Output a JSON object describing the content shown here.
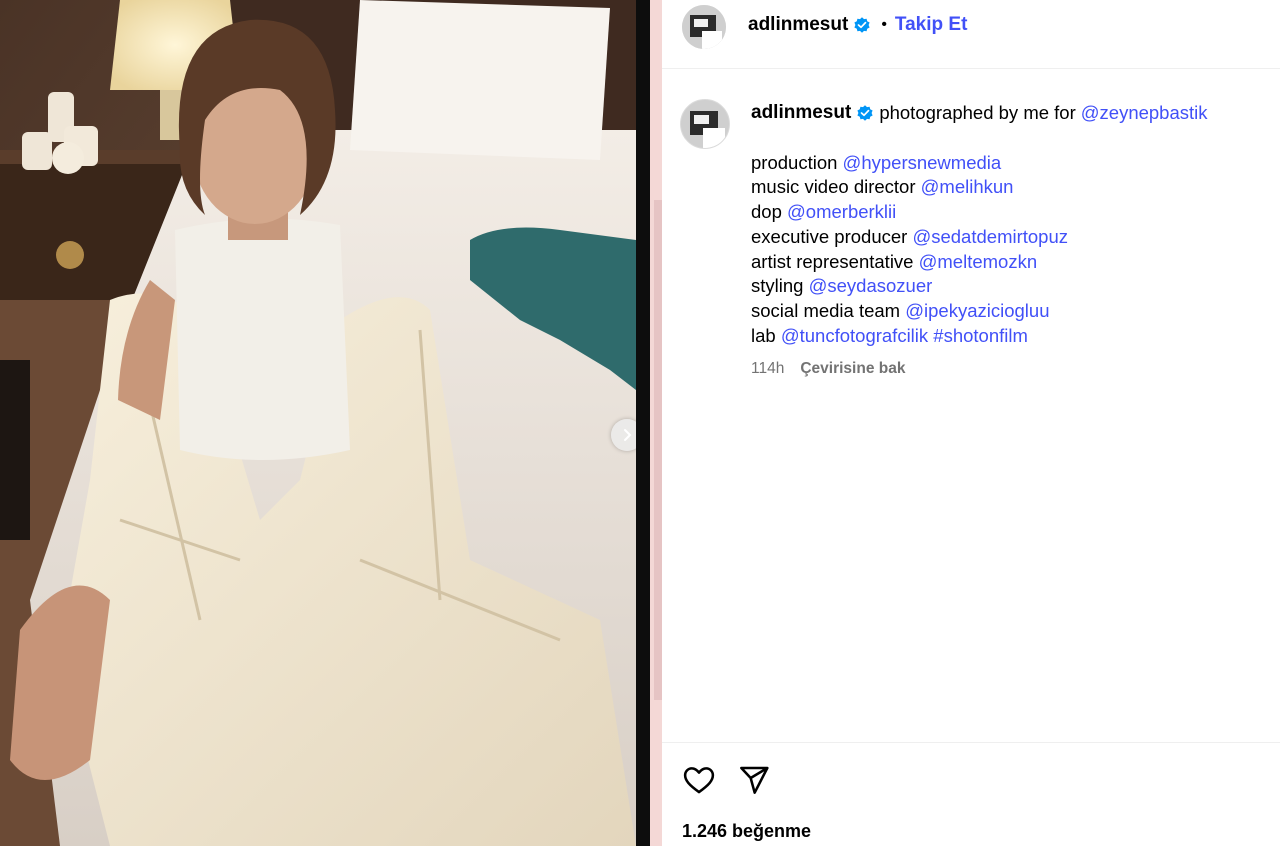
{
  "post": {
    "username": "adlinmesut",
    "follow_label": "Takip Et",
    "separator": "•"
  },
  "caption": {
    "username": "adlinmesut",
    "intro_text": "photographed by me for",
    "intro_mention": "@zeynepbastik",
    "credits": [
      {
        "label": "production",
        "mention": "@hypersnewmedia"
      },
      {
        "label": "music video director",
        "mention": "@melihkun"
      },
      {
        "label": "dop",
        "mention": "@omerberklii"
      },
      {
        "label": "executive producer",
        "mention": "@sedatdemirtopuz"
      },
      {
        "label": "artist representative",
        "mention": "@meltemozkn"
      },
      {
        "label": "styling",
        "mention": "@seydasozuer"
      },
      {
        "label": "social media team",
        "mention": "@ipekyaziciogluu"
      },
      {
        "label": "lab",
        "mention": "@tuncfotografcilik #shotonfilm"
      }
    ],
    "time": "114h",
    "translate_label": "Çevirisine bak"
  },
  "footer": {
    "likes": "1.246 beğenme"
  },
  "icons": {
    "like": "heart-icon",
    "share": "paper-plane-icon",
    "verified": "verified-badge-icon",
    "next": "chevron-right-icon"
  },
  "colors": {
    "accent": "#4150f7",
    "verified": "#0095f6",
    "muted": "#737373"
  }
}
